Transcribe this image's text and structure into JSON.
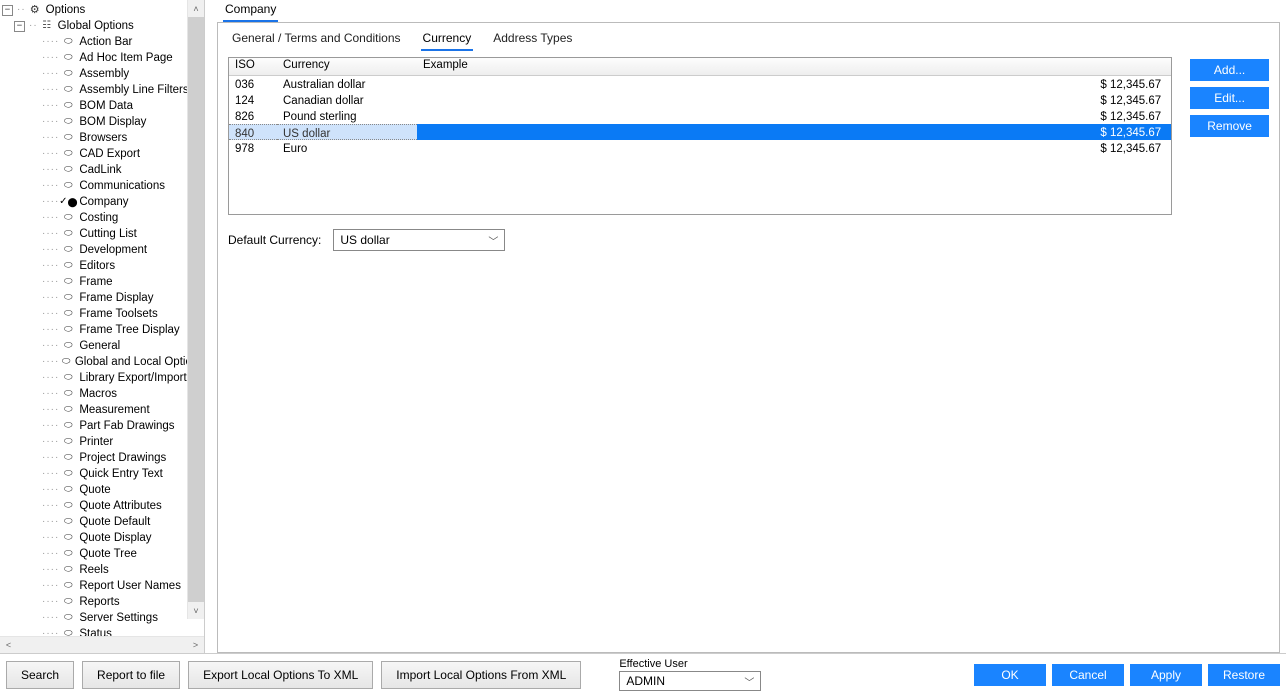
{
  "tree": {
    "root": {
      "label": "Options",
      "expander": "−",
      "icon": "gear"
    },
    "group": {
      "label": "Global Options",
      "expander": "−",
      "icon": "cfg"
    },
    "items": [
      {
        "label": "Action Bar"
      },
      {
        "label": "Ad Hoc Item Page"
      },
      {
        "label": "Assembly"
      },
      {
        "label": "Assembly Line Filters"
      },
      {
        "label": "BOM Data"
      },
      {
        "label": "BOM Display"
      },
      {
        "label": "Browsers"
      },
      {
        "label": "CAD Export"
      },
      {
        "label": "CadLink"
      },
      {
        "label": "Communications"
      },
      {
        "label": "Company",
        "selected": true
      },
      {
        "label": "Costing"
      },
      {
        "label": "Cutting List"
      },
      {
        "label": "Development"
      },
      {
        "label": "Editors"
      },
      {
        "label": "Frame"
      },
      {
        "label": "Frame Display"
      },
      {
        "label": "Frame Toolsets"
      },
      {
        "label": "Frame Tree Display"
      },
      {
        "label": "General"
      },
      {
        "label": "Global and Local Options"
      },
      {
        "label": "Library Export/Import"
      },
      {
        "label": "Macros"
      },
      {
        "label": "Measurement"
      },
      {
        "label": "Part Fab Drawings"
      },
      {
        "label": "Printer"
      },
      {
        "label": "Project Drawings"
      },
      {
        "label": "Quick Entry Text"
      },
      {
        "label": "Quote"
      },
      {
        "label": "Quote Attributes"
      },
      {
        "label": "Quote Default"
      },
      {
        "label": "Quote Display"
      },
      {
        "label": "Quote Tree"
      },
      {
        "label": "Reels"
      },
      {
        "label": "Report User Names"
      },
      {
        "label": "Reports"
      },
      {
        "label": "Server Settings"
      },
      {
        "label": "Status"
      }
    ]
  },
  "top_tabs": [
    {
      "label": "Company",
      "active": true
    }
  ],
  "sub_tabs": [
    {
      "label": "General / Terms and Conditions",
      "active": false
    },
    {
      "label": "Currency",
      "active": true
    },
    {
      "label": "Address Types",
      "active": false
    }
  ],
  "grid": {
    "headers": {
      "iso": "ISO",
      "currency": "Currency",
      "example": "Example"
    },
    "rows": [
      {
        "iso": "036",
        "currency": "Australian dollar",
        "example": "$ 12,345.67",
        "selected": false
      },
      {
        "iso": "124",
        "currency": "Canadian dollar",
        "example": "$ 12,345.67",
        "selected": false
      },
      {
        "iso": "826",
        "currency": "Pound sterling",
        "example": "$ 12,345.67",
        "selected": false
      },
      {
        "iso": "840",
        "currency": "US dollar",
        "example": "$ 12,345.67",
        "selected": true
      },
      {
        "iso": "978",
        "currency": "Euro",
        "example": "$ 12,345.67",
        "selected": false
      }
    ]
  },
  "side_buttons": {
    "add": "Add...",
    "edit": "Edit...",
    "remove": "Remove"
  },
  "default_currency": {
    "label": "Default Currency:",
    "value": "US dollar"
  },
  "bottom": {
    "search": "Search",
    "report": "Report to file",
    "export": "Export Local Options To XML",
    "import": "Import Local Options From XML",
    "eff_user_label": "Effective User",
    "eff_user_value": "ADMIN",
    "ok": "OK",
    "cancel": "Cancel",
    "apply": "Apply",
    "restore": "Restore"
  }
}
